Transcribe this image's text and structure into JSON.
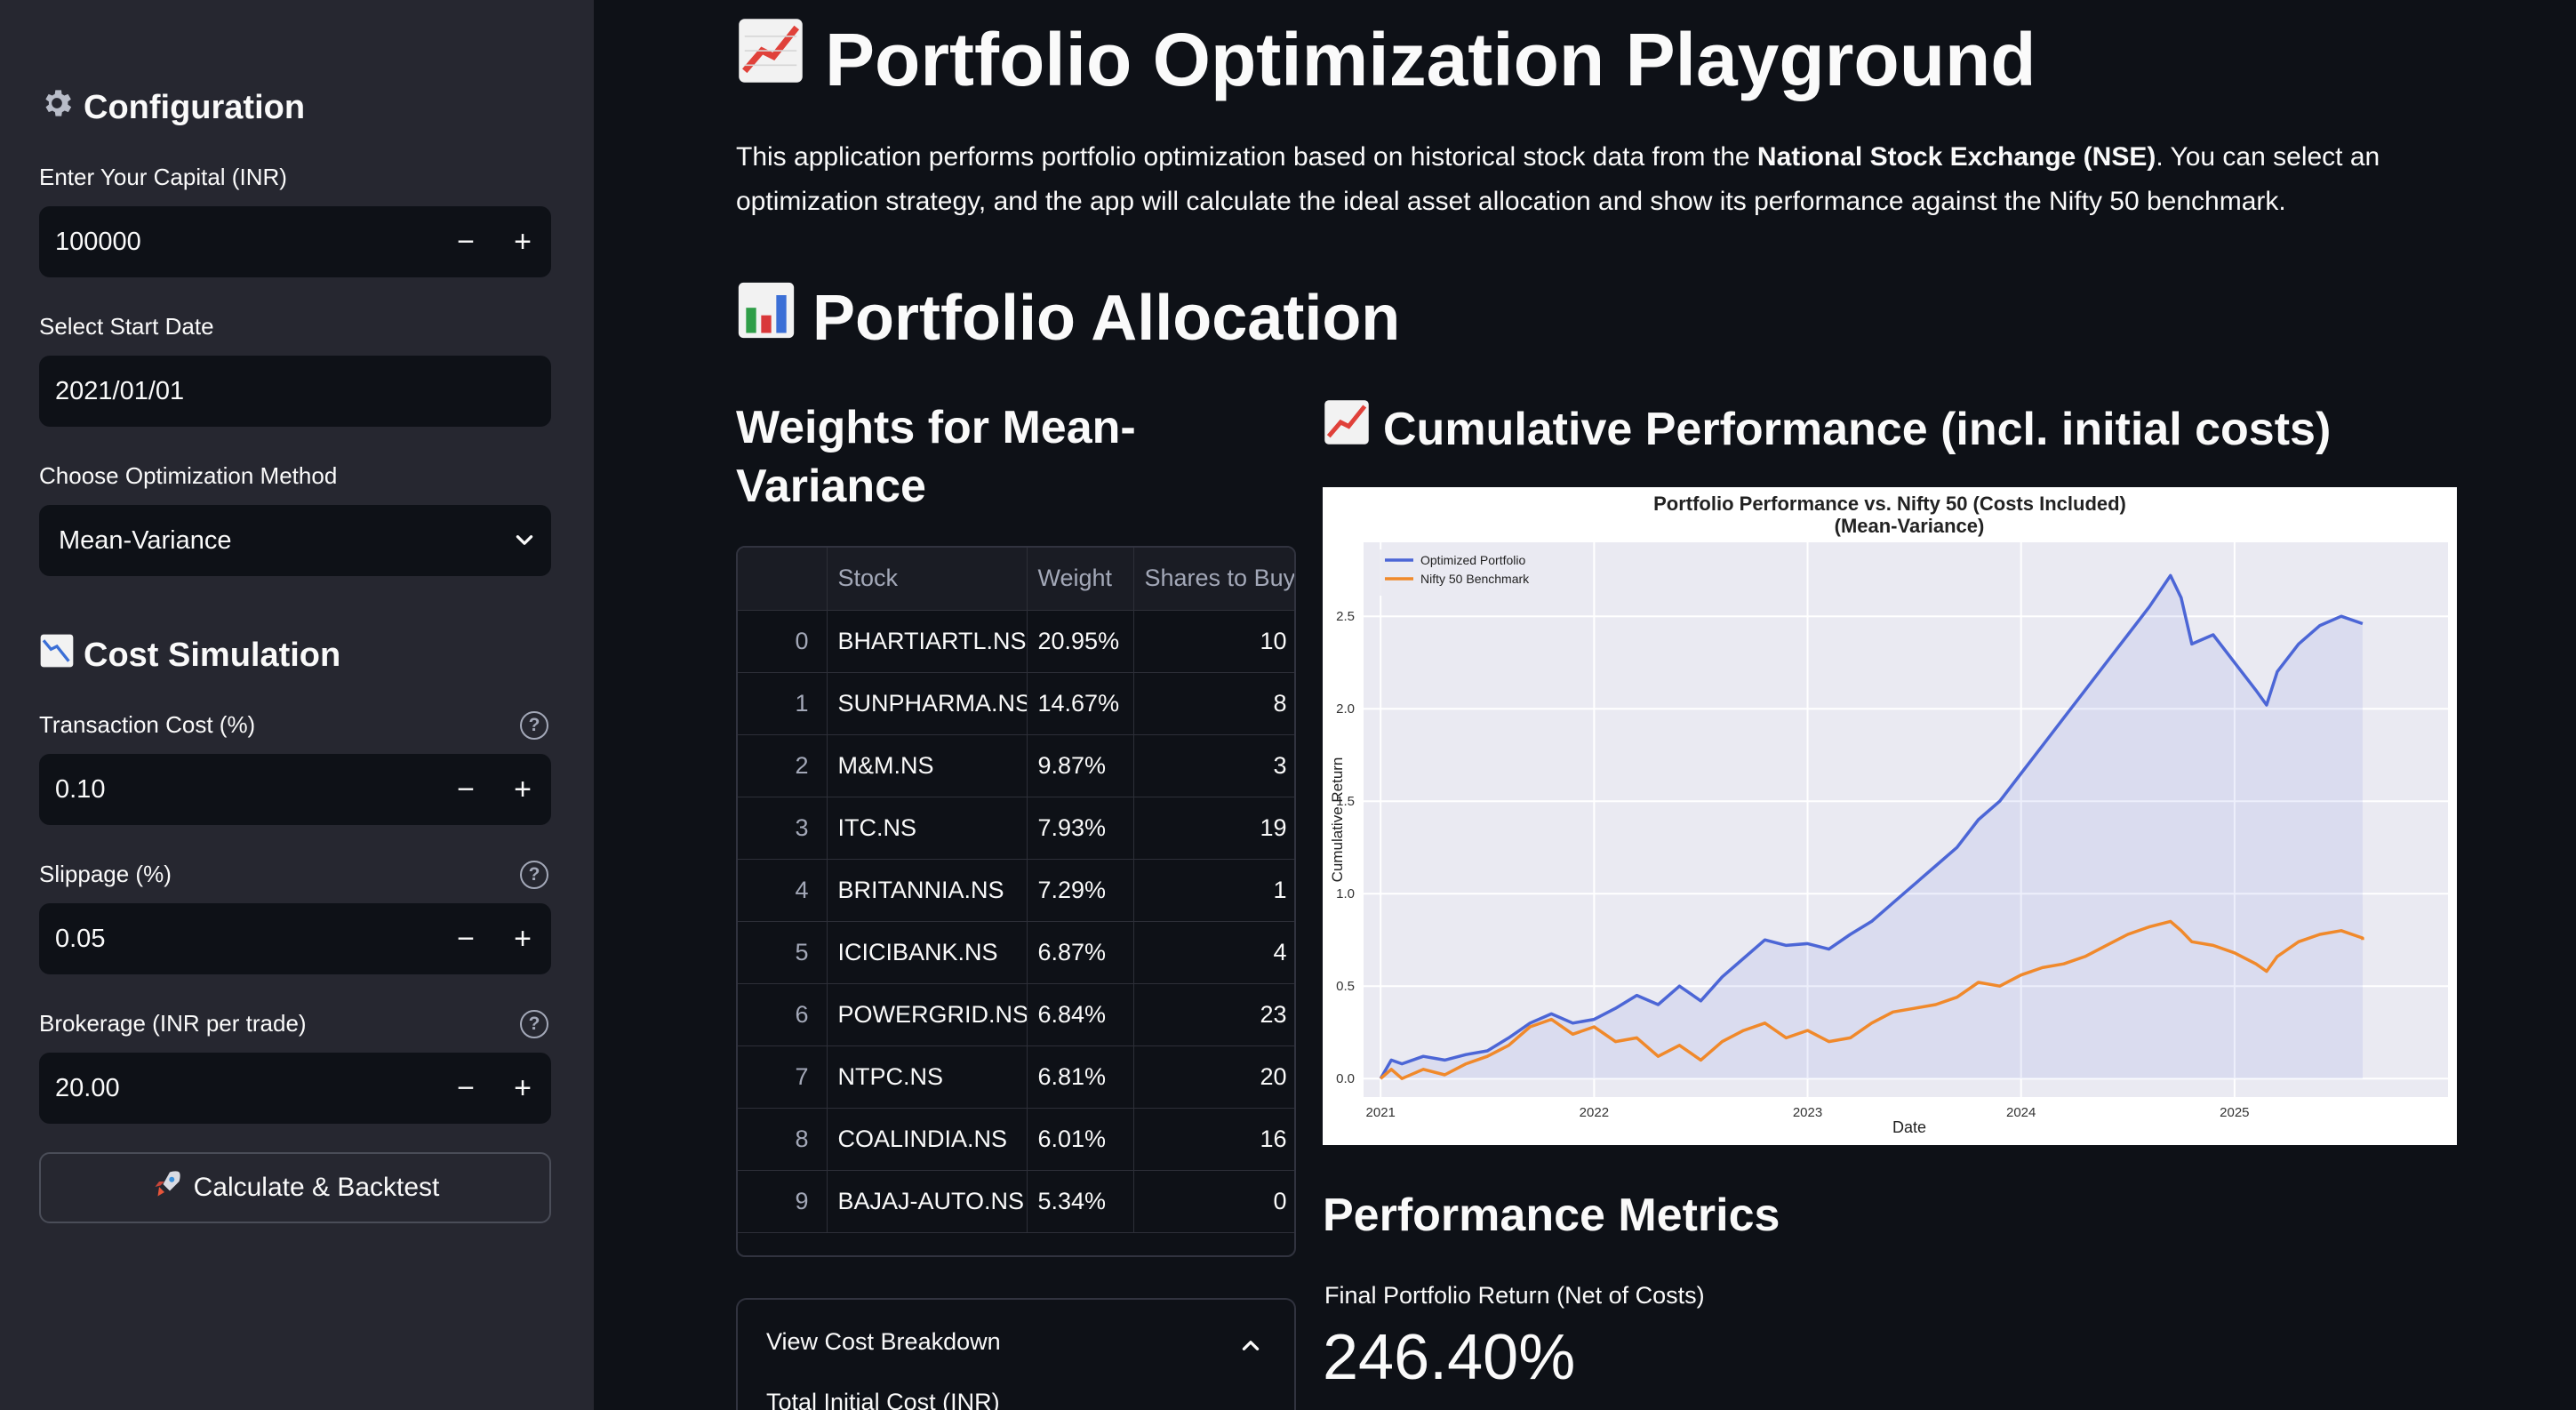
{
  "sidebar": {
    "configuration_heading": "Configuration",
    "capital": {
      "label": "Enter Your Capital (INR)",
      "value": "100000"
    },
    "start_date": {
      "label": "Select Start Date",
      "value": "2021/01/01"
    },
    "method": {
      "label": "Choose Optimization Method",
      "value": "Mean-Variance"
    },
    "cost_heading": "Cost Simulation",
    "transaction_cost": {
      "label": "Transaction Cost (%)",
      "value": "0.10"
    },
    "slippage": {
      "label": "Slippage (%)",
      "value": "0.05"
    },
    "brokerage": {
      "label": "Brokerage (INR per trade)",
      "value": "20.00"
    },
    "calculate_button": "Calculate & Backtest",
    "minus": "−",
    "plus": "+",
    "help": "?"
  },
  "main": {
    "title": "Portfolio Optimization Playground",
    "intro_before": "This application performs portfolio optimization based on historical stock data from the ",
    "intro_bold": "National Stock Exchange (NSE)",
    "intro_after": ". You can select an optimization strategy, and the app will calculate the ideal asset allocation and show its performance against the Nifty 50 benchmark.",
    "allocation_heading": "Portfolio Allocation",
    "weights_heading": "Weights for Mean-Variance",
    "performance_heading": "Cumulative Performance (incl. initial costs)",
    "table": {
      "headers": [
        "",
        "Stock",
        "Weight",
        "Shares to Buy"
      ],
      "rows": [
        [
          "0",
          "BHARTIARTL.NS",
          "20.95%",
          "10"
        ],
        [
          "1",
          "SUNPHARMA.NS",
          "14.67%",
          "8"
        ],
        [
          "2",
          "M&M.NS",
          "9.87%",
          "3"
        ],
        [
          "3",
          "ITC.NS",
          "7.93%",
          "19"
        ],
        [
          "4",
          "BRITANNIA.NS",
          "7.29%",
          "1"
        ],
        [
          "5",
          "ICICIBANK.NS",
          "6.87%",
          "4"
        ],
        [
          "6",
          "POWERGRID.NS",
          "6.84%",
          "23"
        ],
        [
          "7",
          "NTPC.NS",
          "6.81%",
          "20"
        ],
        [
          "8",
          "COALINDIA.NS",
          "6.01%",
          "16"
        ],
        [
          "9",
          "BAJAJ-AUTO.NS",
          "5.34%",
          "0"
        ]
      ]
    },
    "expander": {
      "title": "View Cost Breakdown",
      "row_label": "Total Initial Cost (INR)"
    },
    "metrics_heading": "Performance Metrics",
    "metric": {
      "label": "Final Portfolio Return (Net of Costs)",
      "value": "246.40%"
    }
  },
  "chart_data": {
    "type": "line",
    "title": "Portfolio Performance vs. Nifty 50 (Costs Included)",
    "subtitle": "(Mean-Variance)",
    "xlabel": "Date",
    "ylabel": "Cumulative Return",
    "xlim": [
      2020.92,
      2026.0
    ],
    "ylim": [
      -0.1,
      2.9
    ],
    "x_ticks": [
      2021,
      2022,
      2023,
      2024,
      2025
    ],
    "x_tick_labels": [
      "2021",
      "2022",
      "2023",
      "2024",
      "2025"
    ],
    "y_ticks": [
      0.0,
      0.5,
      1.0,
      1.5,
      2.0,
      2.5
    ],
    "y_tick_labels": [
      "0.0",
      "0.5",
      "1.0",
      "1.5",
      "2.0",
      "2.5"
    ],
    "grid": true,
    "legend": "top-left",
    "series": [
      {
        "name": "Optimized Portfolio",
        "color": "#4c66d6",
        "fill": true,
        "x": [
          2021.0,
          2021.05,
          2021.1,
          2021.2,
          2021.3,
          2021.4,
          2021.5,
          2021.6,
          2021.7,
          2021.8,
          2021.9,
          2022.0,
          2022.1,
          2022.2,
          2022.3,
          2022.4,
          2022.5,
          2022.6,
          2022.7,
          2022.8,
          2022.9,
          2023.0,
          2023.1,
          2023.2,
          2023.3,
          2023.4,
          2023.5,
          2023.6,
          2023.7,
          2023.8,
          2023.9,
          2024.0,
          2024.1,
          2024.2,
          2024.3,
          2024.4,
          2024.5,
          2024.6,
          2024.7,
          2024.75,
          2024.8,
          2024.9,
          2025.0,
          2025.1,
          2025.15,
          2025.2,
          2025.3,
          2025.4,
          2025.5,
          2025.6,
          2025.6
        ],
        "y": [
          0.0,
          0.1,
          0.08,
          0.12,
          0.1,
          0.13,
          0.15,
          0.22,
          0.3,
          0.35,
          0.3,
          0.32,
          0.38,
          0.45,
          0.4,
          0.5,
          0.42,
          0.55,
          0.65,
          0.75,
          0.72,
          0.73,
          0.7,
          0.78,
          0.85,
          0.95,
          1.05,
          1.15,
          1.25,
          1.4,
          1.5,
          1.65,
          1.8,
          1.95,
          2.1,
          2.25,
          2.4,
          2.55,
          2.72,
          2.6,
          2.35,
          2.4,
          2.25,
          2.1,
          2.02,
          2.2,
          2.35,
          2.45,
          2.5,
          2.46,
          2.46
        ]
      },
      {
        "name": "Nifty 50 Benchmark",
        "color": "#f0892b",
        "fill": false,
        "x": [
          2021.0,
          2021.05,
          2021.1,
          2021.2,
          2021.3,
          2021.4,
          2021.5,
          2021.6,
          2021.7,
          2021.8,
          2021.9,
          2022.0,
          2022.1,
          2022.2,
          2022.3,
          2022.4,
          2022.5,
          2022.6,
          2022.7,
          2022.8,
          2022.9,
          2023.0,
          2023.1,
          2023.2,
          2023.3,
          2023.4,
          2023.5,
          2023.6,
          2023.7,
          2023.8,
          2023.9,
          2024.0,
          2024.1,
          2024.2,
          2024.3,
          2024.4,
          2024.5,
          2024.6,
          2024.7,
          2024.75,
          2024.8,
          2024.9,
          2025.0,
          2025.1,
          2025.15,
          2025.2,
          2025.3,
          2025.4,
          2025.5,
          2025.6,
          2025.6
        ],
        "y": [
          0.0,
          0.05,
          0.0,
          0.05,
          0.02,
          0.08,
          0.12,
          0.18,
          0.28,
          0.32,
          0.24,
          0.28,
          0.2,
          0.22,
          0.12,
          0.18,
          0.1,
          0.2,
          0.26,
          0.3,
          0.22,
          0.26,
          0.2,
          0.22,
          0.3,
          0.36,
          0.38,
          0.4,
          0.44,
          0.52,
          0.5,
          0.56,
          0.6,
          0.62,
          0.66,
          0.72,
          0.78,
          0.82,
          0.85,
          0.8,
          0.74,
          0.72,
          0.68,
          0.62,
          0.58,
          0.66,
          0.74,
          0.78,
          0.8,
          0.76,
          0.75
        ]
      }
    ]
  }
}
